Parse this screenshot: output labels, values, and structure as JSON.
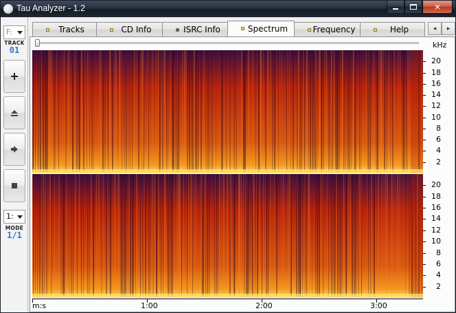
{
  "window": {
    "title": "Tau Analyzer - 1.2"
  },
  "toolbar": {
    "track_combo_value": "F:",
    "track_label": "TRACK",
    "track_value": "01",
    "mode_combo_value": "1:",
    "mode_label": "MODE",
    "mode_value": "1/1"
  },
  "tabs": [
    {
      "label": "Tracks",
      "lamp": "#e7e600",
      "active": false
    },
    {
      "label": "CD Info",
      "lamp": "#e7e600",
      "active": false
    },
    {
      "label": "ISRC Info",
      "lamp": "#555555",
      "active": false
    },
    {
      "label": "Spectrum",
      "lamp": "#e7e600",
      "active": true
    },
    {
      "label": "Frequency",
      "lamp": "#e7e600",
      "active": false
    },
    {
      "label": "Help",
      "lamp": "#e7e600",
      "active": false
    }
  ],
  "tab_scroll": {
    "left": "◂",
    "right": "▸"
  },
  "spectrum": {
    "freq_unit": "kHz",
    "time_unit": "m:s",
    "freq_ticks": [
      "20",
      "18",
      "16",
      "14",
      "12",
      "10",
      "8",
      "6",
      "4",
      "2"
    ],
    "time_ticks": [
      "1:00",
      "2:00",
      "3:00"
    ],
    "colors": {
      "low": "#3a0f3c",
      "mid": "#b8240a",
      "high": "#f39a20",
      "peak": "#ffe070"
    }
  }
}
